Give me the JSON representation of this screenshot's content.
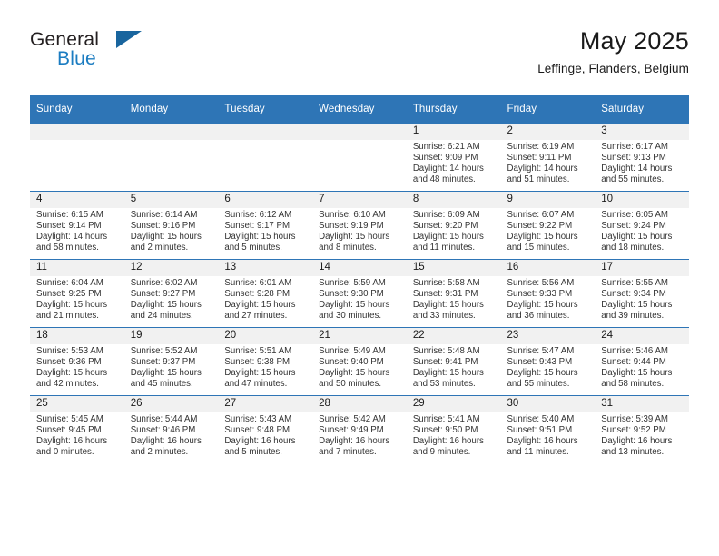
{
  "brand": {
    "name_part1": "General",
    "name_part2": "Blue",
    "triangle_color": "#19659e",
    "blue_color": "#1b7cc1"
  },
  "header": {
    "title": "May 2025",
    "location": "Leffinge, Flanders, Belgium"
  },
  "theme": {
    "header_bg": "#2e75b6",
    "daynum_bg": "#f1f1f1",
    "text": "#1a1a1a"
  },
  "calendar": {
    "weekday_headers": [
      "Sunday",
      "Monday",
      "Tuesday",
      "Wednesday",
      "Thursday",
      "Friday",
      "Saturday"
    ],
    "labels": {
      "sunrise": "Sunrise:",
      "sunset": "Sunset:",
      "daylight": "Daylight:"
    },
    "weeks": [
      [
        {
          "day": "",
          "empty": true
        },
        {
          "day": "",
          "empty": true
        },
        {
          "day": "",
          "empty": true
        },
        {
          "day": "",
          "empty": true
        },
        {
          "day": "1",
          "sunrise": "Sunrise: 6:21 AM",
          "sunset": "Sunset: 9:09 PM",
          "daylight_l1": "Daylight: 14 hours",
          "daylight_l2": "and 48 minutes."
        },
        {
          "day": "2",
          "sunrise": "Sunrise: 6:19 AM",
          "sunset": "Sunset: 9:11 PM",
          "daylight_l1": "Daylight: 14 hours",
          "daylight_l2": "and 51 minutes."
        },
        {
          "day": "3",
          "sunrise": "Sunrise: 6:17 AM",
          "sunset": "Sunset: 9:13 PM",
          "daylight_l1": "Daylight: 14 hours",
          "daylight_l2": "and 55 minutes."
        }
      ],
      [
        {
          "day": "4",
          "sunrise": "Sunrise: 6:15 AM",
          "sunset": "Sunset: 9:14 PM",
          "daylight_l1": "Daylight: 14 hours",
          "daylight_l2": "and 58 minutes."
        },
        {
          "day": "5",
          "sunrise": "Sunrise: 6:14 AM",
          "sunset": "Sunset: 9:16 PM",
          "daylight_l1": "Daylight: 15 hours",
          "daylight_l2": "and 2 minutes."
        },
        {
          "day": "6",
          "sunrise": "Sunrise: 6:12 AM",
          "sunset": "Sunset: 9:17 PM",
          "daylight_l1": "Daylight: 15 hours",
          "daylight_l2": "and 5 minutes."
        },
        {
          "day": "7",
          "sunrise": "Sunrise: 6:10 AM",
          "sunset": "Sunset: 9:19 PM",
          "daylight_l1": "Daylight: 15 hours",
          "daylight_l2": "and 8 minutes."
        },
        {
          "day": "8",
          "sunrise": "Sunrise: 6:09 AM",
          "sunset": "Sunset: 9:20 PM",
          "daylight_l1": "Daylight: 15 hours",
          "daylight_l2": "and 11 minutes."
        },
        {
          "day": "9",
          "sunrise": "Sunrise: 6:07 AM",
          "sunset": "Sunset: 9:22 PM",
          "daylight_l1": "Daylight: 15 hours",
          "daylight_l2": "and 15 minutes."
        },
        {
          "day": "10",
          "sunrise": "Sunrise: 6:05 AM",
          "sunset": "Sunset: 9:24 PM",
          "daylight_l1": "Daylight: 15 hours",
          "daylight_l2": "and 18 minutes."
        }
      ],
      [
        {
          "day": "11",
          "sunrise": "Sunrise: 6:04 AM",
          "sunset": "Sunset: 9:25 PM",
          "daylight_l1": "Daylight: 15 hours",
          "daylight_l2": "and 21 minutes."
        },
        {
          "day": "12",
          "sunrise": "Sunrise: 6:02 AM",
          "sunset": "Sunset: 9:27 PM",
          "daylight_l1": "Daylight: 15 hours",
          "daylight_l2": "and 24 minutes."
        },
        {
          "day": "13",
          "sunrise": "Sunrise: 6:01 AM",
          "sunset": "Sunset: 9:28 PM",
          "daylight_l1": "Daylight: 15 hours",
          "daylight_l2": "and 27 minutes."
        },
        {
          "day": "14",
          "sunrise": "Sunrise: 5:59 AM",
          "sunset": "Sunset: 9:30 PM",
          "daylight_l1": "Daylight: 15 hours",
          "daylight_l2": "and 30 minutes."
        },
        {
          "day": "15",
          "sunrise": "Sunrise: 5:58 AM",
          "sunset": "Sunset: 9:31 PM",
          "daylight_l1": "Daylight: 15 hours",
          "daylight_l2": "and 33 minutes."
        },
        {
          "day": "16",
          "sunrise": "Sunrise: 5:56 AM",
          "sunset": "Sunset: 9:33 PM",
          "daylight_l1": "Daylight: 15 hours",
          "daylight_l2": "and 36 minutes."
        },
        {
          "day": "17",
          "sunrise": "Sunrise: 5:55 AM",
          "sunset": "Sunset: 9:34 PM",
          "daylight_l1": "Daylight: 15 hours",
          "daylight_l2": "and 39 minutes."
        }
      ],
      [
        {
          "day": "18",
          "sunrise": "Sunrise: 5:53 AM",
          "sunset": "Sunset: 9:36 PM",
          "daylight_l1": "Daylight: 15 hours",
          "daylight_l2": "and 42 minutes."
        },
        {
          "day": "19",
          "sunrise": "Sunrise: 5:52 AM",
          "sunset": "Sunset: 9:37 PM",
          "daylight_l1": "Daylight: 15 hours",
          "daylight_l2": "and 45 minutes."
        },
        {
          "day": "20",
          "sunrise": "Sunrise: 5:51 AM",
          "sunset": "Sunset: 9:38 PM",
          "daylight_l1": "Daylight: 15 hours",
          "daylight_l2": "and 47 minutes."
        },
        {
          "day": "21",
          "sunrise": "Sunrise: 5:49 AM",
          "sunset": "Sunset: 9:40 PM",
          "daylight_l1": "Daylight: 15 hours",
          "daylight_l2": "and 50 minutes."
        },
        {
          "day": "22",
          "sunrise": "Sunrise: 5:48 AM",
          "sunset": "Sunset: 9:41 PM",
          "daylight_l1": "Daylight: 15 hours",
          "daylight_l2": "and 53 minutes."
        },
        {
          "day": "23",
          "sunrise": "Sunrise: 5:47 AM",
          "sunset": "Sunset: 9:43 PM",
          "daylight_l1": "Daylight: 15 hours",
          "daylight_l2": "and 55 minutes."
        },
        {
          "day": "24",
          "sunrise": "Sunrise: 5:46 AM",
          "sunset": "Sunset: 9:44 PM",
          "daylight_l1": "Daylight: 15 hours",
          "daylight_l2": "and 58 minutes."
        }
      ],
      [
        {
          "day": "25",
          "sunrise": "Sunrise: 5:45 AM",
          "sunset": "Sunset: 9:45 PM",
          "daylight_l1": "Daylight: 16 hours",
          "daylight_l2": "and 0 minutes."
        },
        {
          "day": "26",
          "sunrise": "Sunrise: 5:44 AM",
          "sunset": "Sunset: 9:46 PM",
          "daylight_l1": "Daylight: 16 hours",
          "daylight_l2": "and 2 minutes."
        },
        {
          "day": "27",
          "sunrise": "Sunrise: 5:43 AM",
          "sunset": "Sunset: 9:48 PM",
          "daylight_l1": "Daylight: 16 hours",
          "daylight_l2": "and 5 minutes."
        },
        {
          "day": "28",
          "sunrise": "Sunrise: 5:42 AM",
          "sunset": "Sunset: 9:49 PM",
          "daylight_l1": "Daylight: 16 hours",
          "daylight_l2": "and 7 minutes."
        },
        {
          "day": "29",
          "sunrise": "Sunrise: 5:41 AM",
          "sunset": "Sunset: 9:50 PM",
          "daylight_l1": "Daylight: 16 hours",
          "daylight_l2": "and 9 minutes."
        },
        {
          "day": "30",
          "sunrise": "Sunrise: 5:40 AM",
          "sunset": "Sunset: 9:51 PM",
          "daylight_l1": "Daylight: 16 hours",
          "daylight_l2": "and 11 minutes."
        },
        {
          "day": "31",
          "sunrise": "Sunrise: 5:39 AM",
          "sunset": "Sunset: 9:52 PM",
          "daylight_l1": "Daylight: 16 hours",
          "daylight_l2": "and 13 minutes."
        }
      ]
    ]
  }
}
